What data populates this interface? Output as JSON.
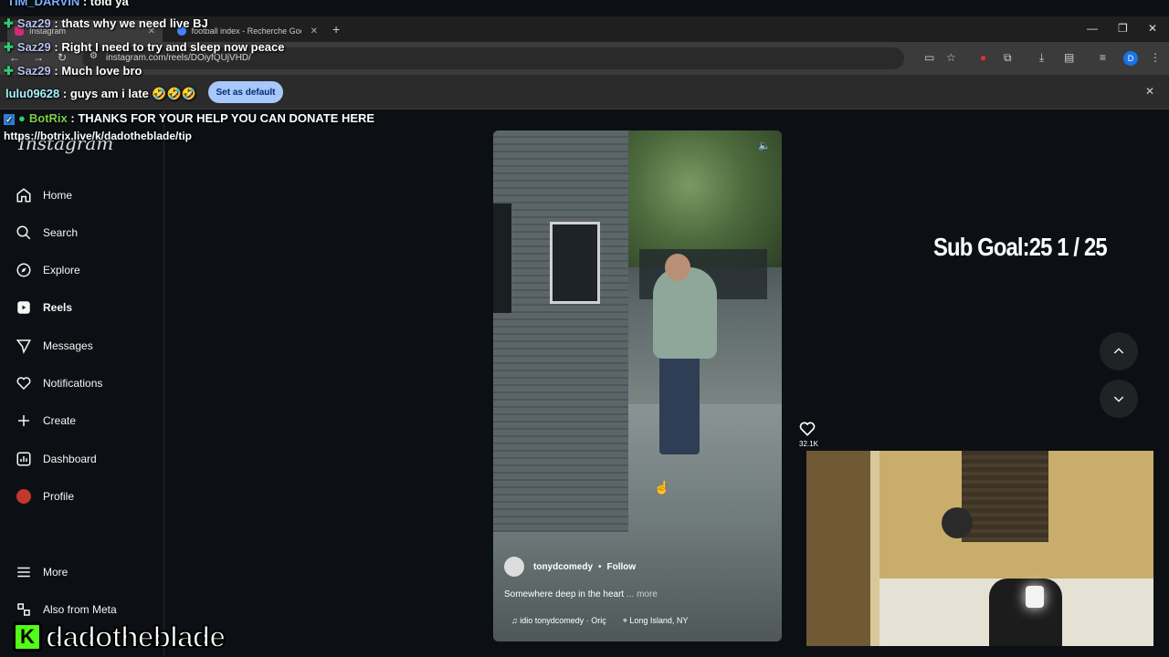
{
  "browser": {
    "tabs": [
      {
        "label": "Instagram",
        "active": true
      },
      {
        "label": "football index - Recherche Goo",
        "active": false
      }
    ],
    "url": "instagram.com/reels/DOiyfQUjVHD/",
    "infobar_button": "Set as default",
    "profile_initial": "D"
  },
  "sidebar": {
    "logo": "Instagram",
    "items": [
      {
        "label": "Home",
        "icon": "home-icon"
      },
      {
        "label": "Search",
        "icon": "search-icon"
      },
      {
        "label": "Explore",
        "icon": "explore-icon"
      },
      {
        "label": "Reels",
        "icon": "reels-icon"
      },
      {
        "label": "Messages",
        "icon": "messages-icon"
      },
      {
        "label": "Notifications",
        "icon": "heart-icon"
      },
      {
        "label": "Create",
        "icon": "plus-icon"
      },
      {
        "label": "Dashboard",
        "icon": "dashboard-icon"
      },
      {
        "label": "Profile",
        "icon": "avatar-icon"
      }
    ],
    "more": "More",
    "also_from_meta": "Also from Meta"
  },
  "reel": {
    "username": "tonydcomedy",
    "follow": "Follow",
    "caption": "Somewhere deep in the heart",
    "caption_more": "... more",
    "audio": "♫ idio  tonydcomedy · Oriç",
    "location": "Long Island, NY",
    "likes": "32.1K"
  },
  "overlay": {
    "sub_goal": "Sub Goal:25  1 / 25",
    "streamer": "dadotheblade",
    "chat": [
      {
        "user": "TIM_DARVIN",
        "msg": "told ya",
        "cls": "user-tim"
      },
      {
        "user": "Saz29",
        "msg": "thats why we need live BJ",
        "cls": "user-saz"
      },
      {
        "user": "Saz29",
        "msg": "Right I need to try and sleep now peace",
        "cls": "user-saz"
      },
      {
        "user": "Saz29",
        "msg": "Much love bro",
        "cls": "user-saz"
      },
      {
        "user": "lulu09628",
        "msg": "guys am i late 🤣🤣🤣",
        "cls": "user-lulu"
      },
      {
        "user": "BotRix",
        "msg": "THANKS FOR YOUR HELP YOU CAN DONATE HERE",
        "cls": "user-bot"
      }
    ],
    "donate_link": "https://botrix.live/k/dadotheblade/tip"
  }
}
